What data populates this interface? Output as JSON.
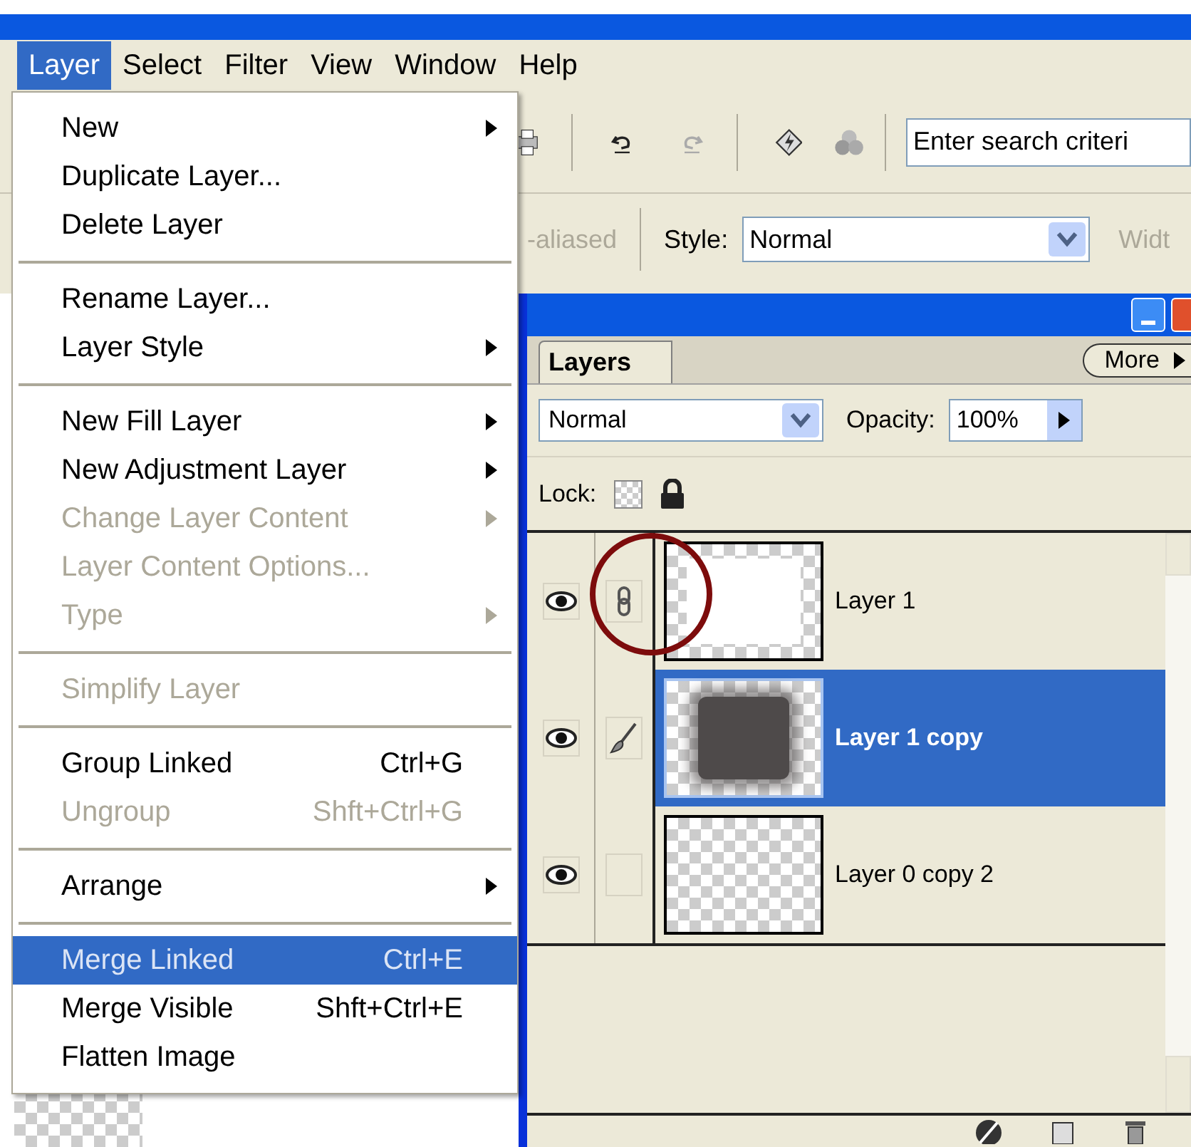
{
  "menu_bar": [
    {
      "label": "Layer",
      "selected": true
    },
    {
      "label": "Select",
      "selected": false
    },
    {
      "label": "Filter",
      "selected": false
    },
    {
      "label": "View",
      "selected": false
    },
    {
      "label": "Window",
      "selected": false
    },
    {
      "label": "Help",
      "selected": false
    }
  ],
  "toolbar": {
    "search": {
      "placeholder": "Enter search criteri"
    }
  },
  "options_bar": {
    "partial_label": "-aliased",
    "style_label": "Style:",
    "style_value": "Normal",
    "width_label": "Widt"
  },
  "layer_menu": {
    "items": [
      {
        "kind": "item",
        "label": "New",
        "submenu": true,
        "disabled": false,
        "selected": false
      },
      {
        "kind": "item",
        "label": "Duplicate Layer...",
        "submenu": false,
        "disabled": false,
        "selected": false
      },
      {
        "kind": "item",
        "label": "Delete Layer",
        "submenu": false,
        "disabled": false,
        "selected": false
      },
      {
        "kind": "separator"
      },
      {
        "kind": "item",
        "label": "Rename Layer...",
        "submenu": false,
        "disabled": false,
        "selected": false
      },
      {
        "kind": "item",
        "label": "Layer Style",
        "submenu": true,
        "disabled": false,
        "selected": false
      },
      {
        "kind": "separator"
      },
      {
        "kind": "item",
        "label": "New Fill Layer",
        "submenu": true,
        "disabled": false,
        "selected": false
      },
      {
        "kind": "item",
        "label": "New Adjustment Layer",
        "submenu": true,
        "disabled": false,
        "selected": false
      },
      {
        "kind": "item",
        "label": "Change Layer Content",
        "submenu": true,
        "disabled": true,
        "selected": false
      },
      {
        "kind": "item",
        "label": "Layer Content Options...",
        "submenu": false,
        "disabled": true,
        "selected": false
      },
      {
        "kind": "item",
        "label": "Type",
        "submenu": true,
        "disabled": true,
        "selected": false
      },
      {
        "kind": "separator"
      },
      {
        "kind": "item",
        "label": "Simplify Layer",
        "submenu": false,
        "disabled": true,
        "selected": false
      },
      {
        "kind": "separator"
      },
      {
        "kind": "item",
        "label": "Group Linked",
        "shortcut": "Ctrl+G",
        "submenu": false,
        "disabled": false,
        "selected": false
      },
      {
        "kind": "item",
        "label": "Ungroup",
        "shortcut": "Shft+Ctrl+G",
        "submenu": false,
        "disabled": true,
        "selected": false
      },
      {
        "kind": "separator"
      },
      {
        "kind": "item",
        "label": "Arrange",
        "submenu": true,
        "disabled": false,
        "selected": false
      },
      {
        "kind": "separator"
      },
      {
        "kind": "item",
        "label": "Merge Linked",
        "shortcut": "Ctrl+E",
        "submenu": false,
        "disabled": false,
        "selected": true
      },
      {
        "kind": "item",
        "label": "Merge Visible",
        "shortcut": "Shft+Ctrl+E",
        "submenu": false,
        "disabled": false,
        "selected": false
      },
      {
        "kind": "item",
        "label": "Flatten Image",
        "submenu": false,
        "disabled": false,
        "selected": false
      }
    ]
  },
  "layers_panel": {
    "tab": "Layers",
    "more": "More",
    "blend_mode": "Normal",
    "opacity_label": "Opacity:",
    "opacity": "100%",
    "lock_label": "Lock:",
    "layers": [
      {
        "name": "Layer 1",
        "visible": true,
        "badge": {
          "kind": "link"
        },
        "thumb": {
          "kind": "white"
        },
        "selected": false
      },
      {
        "name": "Layer 1 copy",
        "visible": true,
        "badge": {
          "kind": "brush"
        },
        "thumb": {
          "kind": "shadow"
        },
        "selected": true
      },
      {
        "name": "Layer 0 copy 2",
        "visible": true,
        "badge": {
          "kind": "none"
        },
        "thumb": {
          "kind": "empty"
        },
        "selected": false
      }
    ]
  }
}
